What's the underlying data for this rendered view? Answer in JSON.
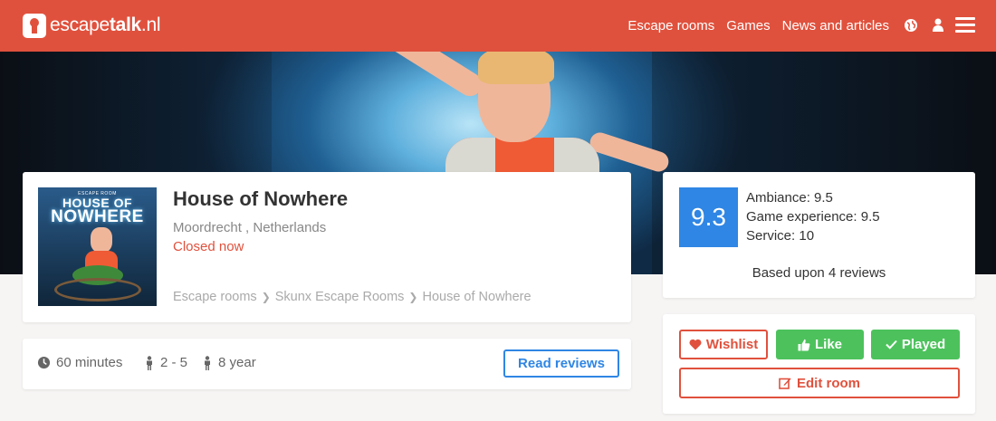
{
  "header": {
    "logo_prefix": "escape",
    "logo_bold": "talk",
    "logo_suffix": ".nl",
    "nav": [
      "Escape rooms",
      "Games",
      "News and articles"
    ],
    "icons": [
      "globe-icon",
      "user-icon",
      "menu-icon"
    ],
    "bg_color": "#e0513d"
  },
  "room": {
    "cover_subtitle": "ESCAPE ROOM",
    "cover_title_1": "HOUSE OF",
    "cover_title_2": "NOWHERE",
    "title": "House of Nowhere",
    "location": "Moordrecht , Netherlands",
    "status": "Closed now",
    "breadcrumbs": [
      "Escape rooms",
      "Skunx Escape Rooms",
      "House of Nowhere"
    ]
  },
  "rating": {
    "score": "9.3",
    "ambiance": "Ambiance: 9.5",
    "game_experience": "Game experience: 9.5",
    "service": "Service: 10",
    "based_upon": "Based upon 4 reviews",
    "score_color": "#2f86e4"
  },
  "info": {
    "duration": "60 minutes",
    "players": "2 - 5",
    "age": "8 year",
    "read_reviews": "Read reviews"
  },
  "actions": {
    "wishlist": "Wishlist",
    "like": "Like",
    "played": "Played",
    "edit_room": "Edit room",
    "accent": "#e0513d",
    "green": "#4dc25c"
  }
}
